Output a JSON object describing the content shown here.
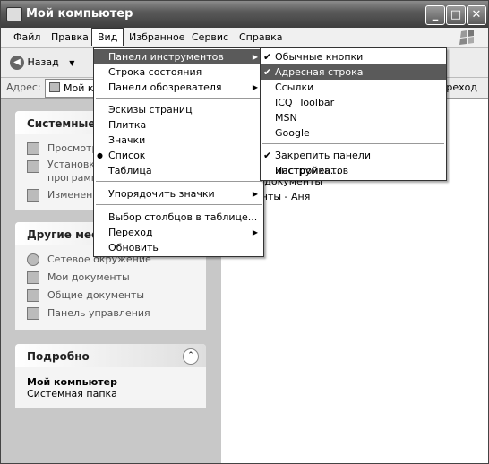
{
  "window": {
    "title": "Мой компьютер"
  },
  "titlebar_buttons": {
    "minimize": "_",
    "maximize": "□",
    "close": "✕"
  },
  "menubar": [
    "Файл",
    "Правка",
    "Вид",
    "Избранное",
    "Сервис",
    "Справка"
  ],
  "toolbar": {
    "back_label": "Назад"
  },
  "address": {
    "label": "Адрес:",
    "value": "Мой к",
    "go_label": "ереход"
  },
  "left": {
    "system": {
      "title": "Системные з",
      "items": [
        "Просмотр",
        "Установк",
        "программ",
        "Изменени"
      ]
    },
    "places": {
      "title": "Другие мест",
      "items": [
        "Сетевое окружение",
        "Мои документы",
        "Общие документы",
        "Панель управления"
      ]
    },
    "details": {
      "title": "Подробно",
      "name": "Мой компьютер",
      "desc": "Системная папка"
    }
  },
  "right": {
    "line1": "е документы",
    "line2": "енты - Аня"
  },
  "view_menu": {
    "items": [
      {
        "label": "Панели инструментов",
        "submenu": true,
        "highlight": true
      },
      {
        "label": "Строка состояния"
      },
      {
        "label": "Панели обозревателя",
        "submenu": true
      },
      {
        "label": "Эскизы страниц"
      },
      {
        "label": "Плитка"
      },
      {
        "label": "Значки"
      },
      {
        "label": "Список",
        "bullet": true
      },
      {
        "label": "Таблица"
      },
      {
        "label": "Упорядочить значки",
        "submenu": true
      },
      {
        "label": "Выбор столбцов в таблице..."
      },
      {
        "label": "Переход",
        "submenu": true
      },
      {
        "label": "Обновить"
      }
    ]
  },
  "toolbars_submenu": {
    "items": [
      {
        "label": "Обычные кнопки",
        "checked": true
      },
      {
        "label": "Адресная строка",
        "checked": true,
        "highlight": true
      },
      {
        "label": "Ссылки"
      },
      {
        "label": "ICQ  Toolbar"
      },
      {
        "label": "MSN"
      },
      {
        "label": "Google"
      },
      {
        "label": "Закрепить панели инструментов",
        "checked": true
      },
      {
        "label": "Настройка..."
      }
    ]
  },
  "glyphs": {
    "check": "✔",
    "bullet": "●",
    "arrow": "▶",
    "collapse": "⌃",
    "dropdown": "▼",
    "back": "◀"
  }
}
